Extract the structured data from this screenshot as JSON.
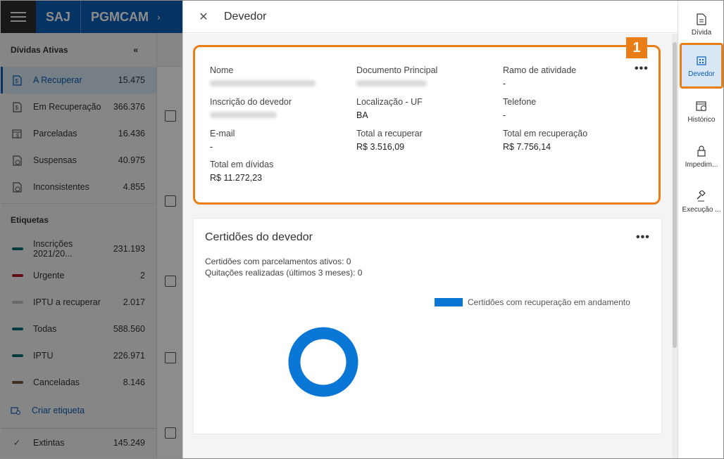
{
  "app": {
    "brand": "SAJ",
    "product": "PGMCAM"
  },
  "sidebar": {
    "section_title": "Dívidas Ativas",
    "collapse_icon": "«",
    "items": [
      {
        "label": "A Recuperar",
        "count": "15.475",
        "active": true
      },
      {
        "label": "Em Recuperação",
        "count": "366.376"
      },
      {
        "label": "Parceladas",
        "count": "16.436"
      },
      {
        "label": "Suspensas",
        "count": "40.975"
      },
      {
        "label": "Inconsistentes",
        "count": "4.855"
      }
    ],
    "tags_title": "Etiquetas",
    "tags": [
      {
        "label": "Inscrições 2021/20...",
        "count": "231.193",
        "color": "#0e6b74"
      },
      {
        "label": "Urgente",
        "count": "2",
        "color": "#b21d24"
      },
      {
        "label": "IPTU a recuperar",
        "count": "2.017",
        "color": "#bdbdbd"
      },
      {
        "label": "Todas",
        "count": "588.560",
        "color": "#0e6b74"
      },
      {
        "label": "IPTU",
        "count": "226.971",
        "color": "#0e6b74"
      },
      {
        "label": "Canceladas",
        "count": "8.146",
        "color": "#7a5035"
      }
    ],
    "create_tag": "Criar etiqueta",
    "bottom": {
      "label": "Extintas",
      "count": "145.249"
    }
  },
  "panel": {
    "title": "Devedor",
    "badge": "1",
    "more": "•••",
    "fields": {
      "nome_label": "Nome",
      "doc_label": "Documento Principal",
      "ramo_label": "Ramo de atividade",
      "ramo_value": "-",
      "inscricao_label": "Inscrição do devedor",
      "local_label": "Localização - UF",
      "local_value": "BA",
      "telefone_label": "Telefone",
      "telefone_value": "-",
      "email_label": "E-mail",
      "email_value": "-",
      "total_recuperar_label": "Total a recuperar",
      "total_recuperar_value": "R$ 3.516,09",
      "total_recuperacao_label": "Total em recuperação",
      "total_recuperacao_value": "R$ 7.756,14",
      "total_dividas_label": "Total em dívidas",
      "total_dividas_value": "R$ 11.272,23"
    },
    "certidoes": {
      "title": "Certidões do devedor",
      "line1": "Certidões com parcelamentos ativos: 0",
      "line2": "Quitações realizadas (últimos 3 meses): 0",
      "more": "•••",
      "chart_data": {
        "type": "pie",
        "title": "",
        "series": [
          {
            "name": "Certidões com recuperação em andamento",
            "values": [
              1
            ]
          }
        ],
        "color": "#0a76d6"
      }
    }
  },
  "rail": {
    "items": [
      {
        "label": "Dívida",
        "icon": "document-icon"
      },
      {
        "label": "Devedor",
        "icon": "building-icon",
        "active": true
      },
      {
        "label": "Histórico",
        "icon": "calendar-clock-icon"
      },
      {
        "label": "Impedim...",
        "icon": "lock-icon"
      },
      {
        "label": "Execução ...",
        "icon": "gavel-icon"
      }
    ]
  }
}
